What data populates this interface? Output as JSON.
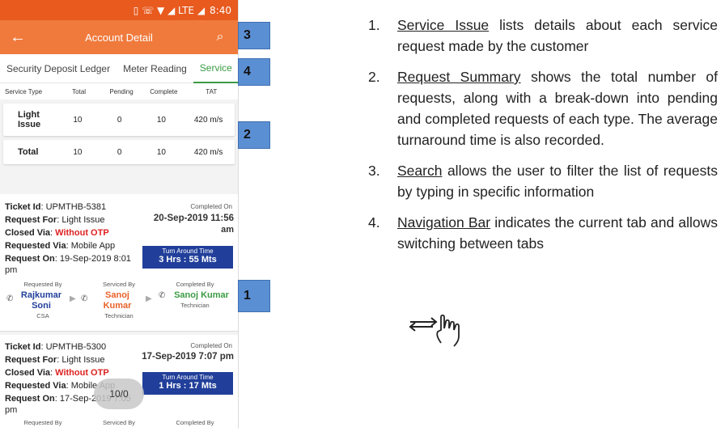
{
  "status_bar": {
    "icons": "▯ ☏ ▼ ◢ LTE ◢",
    "time": "8:40"
  },
  "appbar": {
    "title": "Account Detail",
    "back_icon": "←",
    "search_icon": "⌕"
  },
  "tabs": [
    {
      "label": "Security Deposit Ledger"
    },
    {
      "label": "Meter Reading"
    },
    {
      "label": "Service",
      "active": true
    }
  ],
  "summary_headers": {
    "type": "Service Type",
    "total": "Total",
    "pending": "Pending",
    "complete": "Complete",
    "tat": "TAT"
  },
  "summary_rows": [
    {
      "type": "Light Issue",
      "total": "10",
      "pending": "0",
      "complete": "10",
      "tat": "420 m/s"
    },
    {
      "type": "Total",
      "total": "10",
      "pending": "0",
      "complete": "10",
      "tat": "420 m/s"
    }
  ],
  "tickets": [
    {
      "ticket_label": "Ticket Id",
      "ticket_id": "UPMTHB-5381",
      "request_for_label": "Request For",
      "request_for": "Light Issue",
      "closed_via_label": "Closed Via",
      "closed_via": "Without OTP",
      "requested_via_label": "Requested Via",
      "requested_via": "Mobile App",
      "request_on_label": "Request On",
      "request_on": "19-Sep-2019 8:01",
      "request_on_cont": "pm",
      "completed_on_label": "Completed On",
      "completed_date": "20-Sep-2019 11:56",
      "completed_date_cont": "am",
      "tat_label": "Turn Around Time",
      "tat_value": "3 Hrs : 55 Mts",
      "requested_by_label": "Requested By",
      "requested_by": "Rajkumar Soni",
      "requested_by_role": "CSA",
      "serviced_by_label": "Serviced By",
      "serviced_by": "Sanoj Kumar",
      "serviced_by_role": "Technician",
      "completed_by_label": "Completed By",
      "completed_by": "Sanoj Kumar",
      "completed_by_role": "Technician"
    },
    {
      "ticket_label": "Ticket Id",
      "ticket_id": "UPMTHB-5300",
      "request_for_label": "Request For",
      "request_for": "Light Issue",
      "closed_via_label": "Closed Via",
      "closed_via": "Without OTP",
      "requested_via_label": "Requested Via",
      "requested_via": "Mobile App",
      "request_on_label": "Request On",
      "request_on": "17-Sep-2019 7:05",
      "request_on_cont": "pm",
      "completed_on_label": "Completed On",
      "completed_date": "17-Sep-2019 7:07 pm",
      "tat_label": "Turn Around Time",
      "tat_value": "1 Hrs : 17 Mts",
      "requested_by_label": "Requested By",
      "serviced_by_label": "Serviced By",
      "completed_by_label": "Completed By"
    }
  ],
  "toast": "10/0",
  "callouts": [
    "3",
    "4",
    "2",
    "1"
  ],
  "descriptions": [
    {
      "num": "1.",
      "keyword": "Service Issue",
      "text": " lists details about each service request made by the customer"
    },
    {
      "num": "2.",
      "keyword": "Request Summary",
      "text": " shows the total number of requests, along with a break-down into pending and completed requests of each type. The average turnaround time is also recorded."
    },
    {
      "num": "3.",
      "keyword": "Search",
      "text": " allows the user to filter the list of requests by typing in specific information"
    },
    {
      "num": "4.",
      "keyword": "Navigation Bar",
      "text": " indicates the current tab and allows switching between tabs"
    }
  ],
  "gesture_icon": "swipe-hand-icon",
  "colors": {
    "appbar": "#f07a3c",
    "statusbar": "#e85a1e",
    "active_tab": "#3a9b43",
    "tat_box": "#213f9a",
    "callout": "#5b8fd4",
    "red": "#d22222",
    "person_blue": "#213f9a",
    "person_orange": "#e8622a",
    "person_green": "#3a9b43"
  }
}
